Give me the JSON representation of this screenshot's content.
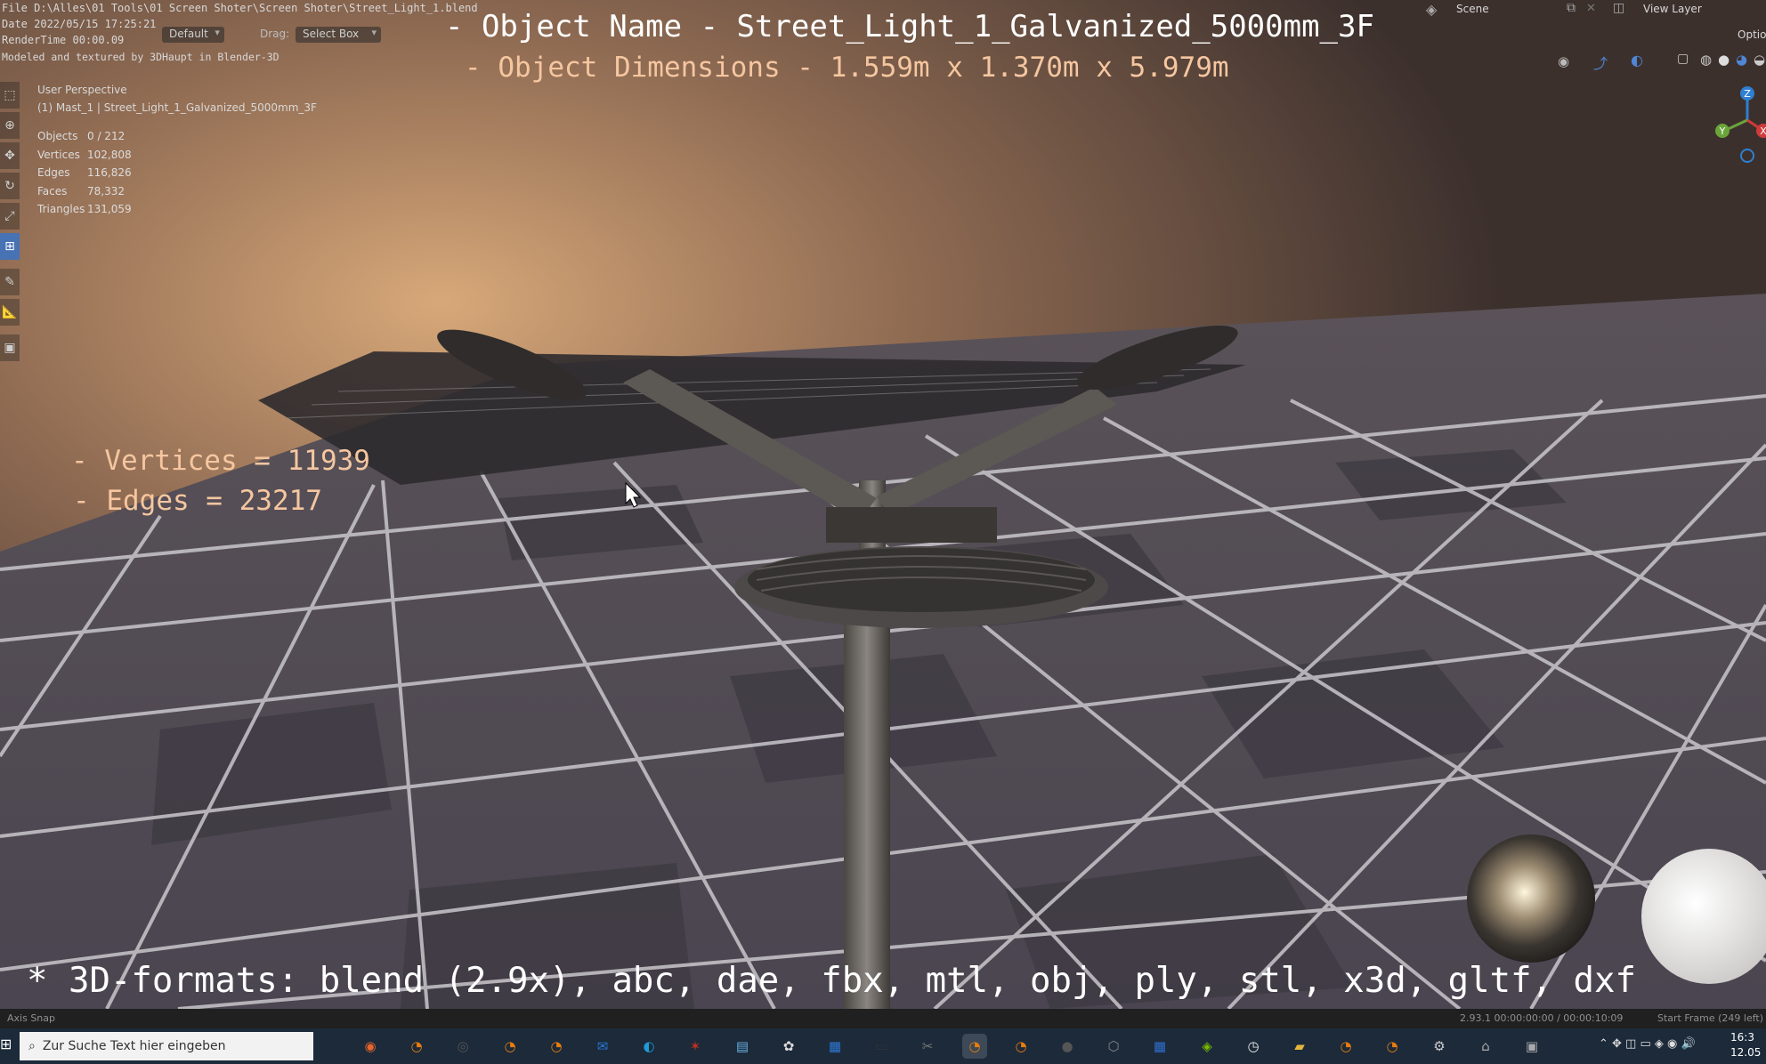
{
  "header": {
    "file_path": "File D:\\Alles\\01 Tools\\01 Screen Shoter\\Screen Shoter\\Street_Light_1.blend",
    "date": "Date 2022/05/15 17:25:21",
    "render_time": "RenderTime 00:00.09",
    "modeled_by": "Modeled and textured by 3DHaupt in Blender-3D",
    "orientation_value": "Default",
    "drag_label": "Drag:",
    "drag_value": "Select Box",
    "scene_label": "Scene",
    "view_layer_label": "View Layer",
    "options_label": "Option"
  },
  "overlay": {
    "object_name": "- Object Name - Street_Light_1_Galvanized_5000mm_3F",
    "object_dimensions": "- Object Dimensions -  1.559m x 1.370m x 5.979m",
    "vertices": "- Vertices = 11939",
    "edges": "- Edges = 23217",
    "formats": "* 3D-formats: blend (2.9x), abc, dae, fbx, mtl, obj, ply, stl, x3d, gltf, dxf"
  },
  "viewport": {
    "perspective": "User Perspective",
    "active_object": "(1) Mast_1 | Street_Light_1_Galvanized_5000mm_3F",
    "stats": [
      {
        "label": "Objects",
        "value": "0 / 212"
      },
      {
        "label": "Vertices",
        "value": "102,808"
      },
      {
        "label": "Edges",
        "value": "116,826"
      },
      {
        "label": "Faces",
        "value": "78,332"
      },
      {
        "label": "Triangles",
        "value": "131,059"
      }
    ],
    "gizmo": {
      "z": "Z",
      "x": "X",
      "y": "Y"
    }
  },
  "toolbar": {
    "tools": [
      {
        "name": "select-box-tool-icon",
        "glyph": "⬚"
      },
      {
        "name": "cursor-tool-icon",
        "glyph": "⊕"
      },
      {
        "name": "move-tool-icon",
        "glyph": "✥"
      },
      {
        "name": "rotate-tool-icon",
        "glyph": "↻"
      },
      {
        "name": "scale-tool-icon",
        "glyph": "⤢"
      },
      {
        "name": "transform-tool-icon",
        "glyph": "⊞"
      },
      {
        "name": "annotate-tool-icon",
        "glyph": "✎"
      },
      {
        "name": "measure-tool-icon",
        "glyph": "📐"
      },
      {
        "name": "add-cube-tool-icon",
        "glyph": "▣"
      }
    ],
    "active_index": 5
  },
  "statusbar": {
    "left": "Axis Snap",
    "version_time": "2.93.1   00:00:00:00 / 00:00:10:09",
    "start_frame": "Start Frame (249 left)"
  },
  "taskbar": {
    "search_placeholder": "Zur Suche Text hier eingeben",
    "clock_time": "16:3",
    "clock_date": "12.05",
    "apps": [
      {
        "name": "firefox-icon",
        "glyph": "◉",
        "color": "#e8652b"
      },
      {
        "name": "blender-icon",
        "glyph": "◔",
        "color": "#e87d0d"
      },
      {
        "name": "obs-icon",
        "glyph": "◎",
        "color": "#555555"
      },
      {
        "name": "blender-icon",
        "glyph": "◔",
        "color": "#e87d0d"
      },
      {
        "name": "blender-icon",
        "glyph": "◔",
        "color": "#e87d0d"
      },
      {
        "name": "mail-icon",
        "glyph": "✉",
        "color": "#2a78d6"
      },
      {
        "name": "edge-icon",
        "glyph": "◐",
        "color": "#1f9bd8"
      },
      {
        "name": "app-icon",
        "glyph": "✶",
        "color": "#c0301e"
      },
      {
        "name": "notes-icon",
        "glyph": "▤",
        "color": "#6aaee0"
      },
      {
        "name": "paint-icon",
        "glyph": "✿",
        "color": "#dddddd"
      },
      {
        "name": "store-icon",
        "glyph": "▦",
        "color": "#2c7ad6"
      },
      {
        "name": "terminal-icon",
        "glyph": "▭",
        "color": "#333333"
      },
      {
        "name": "tool-icon",
        "glyph": "✂",
        "color": "#777777"
      },
      {
        "name": "blender-icon",
        "glyph": "◔",
        "color": "#e87d0d"
      },
      {
        "name": "blender-icon",
        "glyph": "◔",
        "color": "#e87d0d"
      },
      {
        "name": "panda-icon",
        "glyph": "●",
        "color": "#555555"
      },
      {
        "name": "cube-icon",
        "glyph": "⬡",
        "color": "#888888"
      },
      {
        "name": "calendar-icon",
        "glyph": "▦",
        "color": "#2f6fd0"
      },
      {
        "name": "nvidia-icon",
        "glyph": "◈",
        "color": "#76b900"
      },
      {
        "name": "clock-icon",
        "glyph": "◷",
        "color": "#eeeeee"
      },
      {
        "name": "folder-icon",
        "glyph": "▰",
        "color": "#e6b43c"
      },
      {
        "name": "blender-icon",
        "glyph": "◔",
        "color": "#e87d0d"
      },
      {
        "name": "blender-icon",
        "glyph": "◔",
        "color": "#e87d0d"
      },
      {
        "name": "settings-icon",
        "glyph": "⚙",
        "color": "#cccccc"
      },
      {
        "name": "network-icon",
        "glyph": "⌂",
        "color": "#aaaaaa"
      },
      {
        "name": "monitor-icon",
        "glyph": "▣",
        "color": "#aaaaaa"
      }
    ],
    "active_app_index": 13
  }
}
